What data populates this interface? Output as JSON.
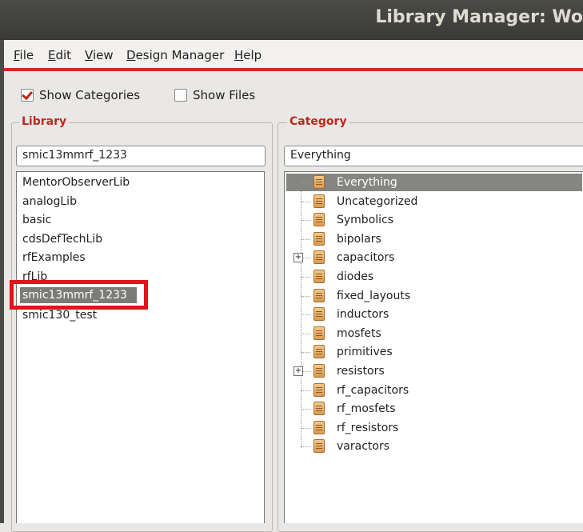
{
  "window": {
    "title": "Library Manager: Wo"
  },
  "menu": [
    {
      "label": "File",
      "mnemonic": "F"
    },
    {
      "label": "Edit",
      "mnemonic": "E"
    },
    {
      "label": "View",
      "mnemonic": "V"
    },
    {
      "label": "Design Manager",
      "mnemonic": "D"
    },
    {
      "label": "Help",
      "mnemonic": "H"
    }
  ],
  "options": {
    "show_categories": {
      "label": "Show Categories",
      "checked": true
    },
    "show_files": {
      "label": "Show Files",
      "checked": false
    }
  },
  "library": {
    "group_label": "Library",
    "filter_value": "smic13mmrf_1233",
    "items": [
      "MentorObserverLib",
      "analogLib",
      "basic",
      "cdsDefTechLib",
      "rfExamples",
      "rfLib",
      "smic13mmrf_1233",
      "smic130_test"
    ],
    "selected": "smic13mmrf_1233"
  },
  "category": {
    "group_label": "Category",
    "filter_value": "Everything",
    "items": [
      {
        "label": "Everything",
        "expandable": false,
        "selected": true
      },
      {
        "label": "Uncategorized",
        "expandable": false
      },
      {
        "label": "Symbolics",
        "expandable": false
      },
      {
        "label": "bipolars",
        "expandable": false
      },
      {
        "label": "capacitors",
        "expandable": true
      },
      {
        "label": "diodes",
        "expandable": false
      },
      {
        "label": "fixed_layouts",
        "expandable": false
      },
      {
        "label": "inductors",
        "expandable": false
      },
      {
        "label": "mosfets",
        "expandable": false
      },
      {
        "label": "primitives",
        "expandable": false
      },
      {
        "label": "resistors",
        "expandable": true
      },
      {
        "label": "rf_capacitors",
        "expandable": false
      },
      {
        "label": "rf_mosfets",
        "expandable": false
      },
      {
        "label": "rf_resistors",
        "expandable": false
      },
      {
        "label": "varactors",
        "expandable": false
      }
    ]
  },
  "colors": {
    "accent": "#c0271b",
    "highlight_box": "#e4121a",
    "selection": "#7b7b78"
  },
  "icons": {
    "category": "category-scroll-icon",
    "expander": "plus-expander-icon",
    "check": "checkmark-icon"
  }
}
